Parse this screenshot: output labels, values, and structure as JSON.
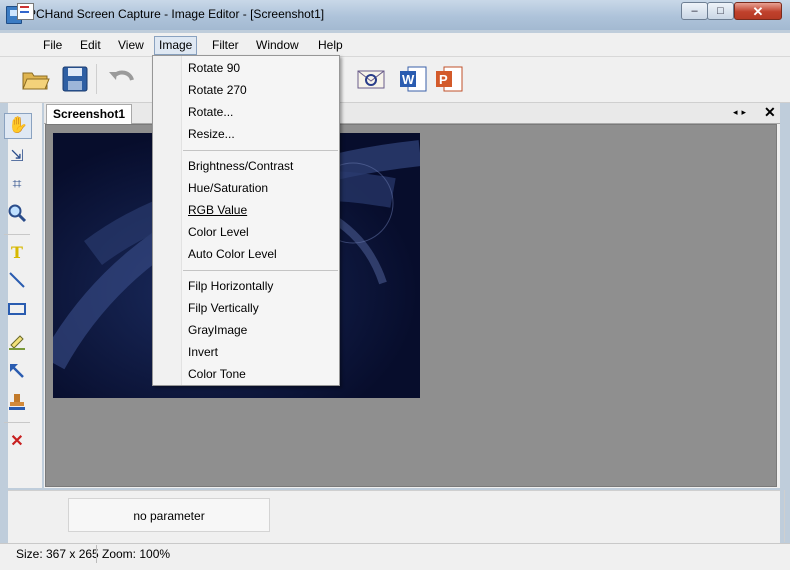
{
  "window": {
    "title": "PCHand Screen Capture - Image Editor - [Screenshot1]",
    "controls": {
      "minimize": "–",
      "maximize": "□",
      "close": "✕"
    }
  },
  "menubar": {
    "items": [
      {
        "label": "File"
      },
      {
        "label": "Edit"
      },
      {
        "label": "View"
      },
      {
        "label": "Image"
      },
      {
        "label": "Filter"
      },
      {
        "label": "Window"
      },
      {
        "label": "Help"
      }
    ]
  },
  "toolbar": {
    "icons": [
      "open-folder-icon",
      "save-disk-icon",
      "undo-icon",
      "email-icon",
      "word-icon",
      "powerpoint-icon"
    ]
  },
  "tools": [
    "hand-icon",
    "select-move-icon",
    "crop-icon",
    "zoom-icon",
    "text-icon",
    "line-icon",
    "rectangle-icon",
    "highlighter-icon",
    "arrow-icon",
    "stamp-icon",
    "delete-icon"
  ],
  "document": {
    "tab_label": "Screenshot1",
    "tab_nav": "◂▸",
    "tab_close": "✕"
  },
  "image_menu": {
    "items": [
      {
        "label": "Rotate 90"
      },
      {
        "label": "Rotate 270"
      },
      {
        "label": "Rotate..."
      },
      {
        "label": "Resize..."
      },
      {
        "label": "Brightness/Contrast"
      },
      {
        "label": "Hue/Saturation"
      },
      {
        "label": "RGB Value"
      },
      {
        "label": "Color Level"
      },
      {
        "label": "Auto Color Level"
      },
      {
        "label": "Filp Horizontally"
      },
      {
        "label": "Filp Vertically"
      },
      {
        "label": "GrayImage"
      },
      {
        "label": "Invert"
      },
      {
        "label": "Color Tone"
      }
    ]
  },
  "parameter_panel": {
    "text": "no parameter"
  },
  "status": {
    "size": "Size: 367 x 265",
    "zoom": "Zoom: 100%"
  },
  "colors": {
    "accent": "#3b7cc4",
    "canvas": "#8f8f8f",
    "image_bg": "#070d2c"
  }
}
